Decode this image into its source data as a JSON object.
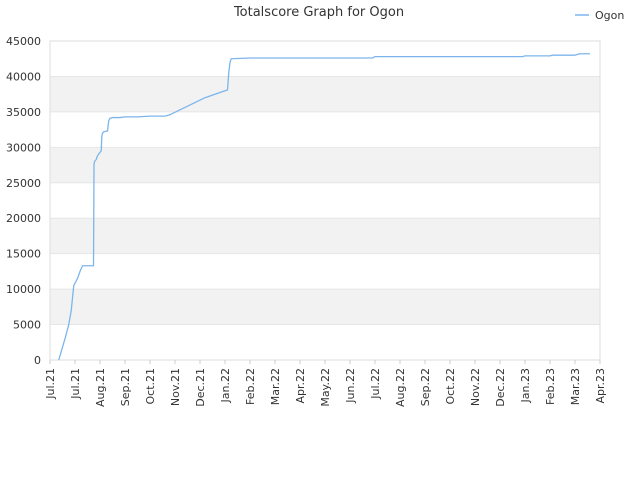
{
  "chart_data": {
    "type": "line",
    "title": "Totalscore Graph for Ogon",
    "xlabel": "",
    "ylabel": "",
    "ylim": [
      0,
      45000
    ],
    "yticks": [
      0,
      5000,
      10000,
      15000,
      20000,
      25000,
      30000,
      35000,
      40000,
      45000
    ],
    "xtick_labels": [
      "Jul.21",
      "Jul.21",
      "Aug.21",
      "Sep.21",
      "Oct.21",
      "Nov.21",
      "Dec.21",
      "Jan.22",
      "Feb.22",
      "Mar.22",
      "Apr.22",
      "May.22",
      "Jun.22",
      "Jul.22",
      "Aug.22",
      "Sep.22",
      "Oct.22",
      "Nov.22",
      "Dec.22",
      "Jan.23",
      "Feb.23",
      "Mar.23",
      "Apr.23"
    ],
    "grid": true,
    "legend_position": "top-right",
    "series": [
      {
        "name": "Ogon",
        "color": "#7cb5ec",
        "points": [
          [
            0.35,
            0
          ],
          [
            0.6,
            3000
          ],
          [
            0.75,
            5000
          ],
          [
            0.85,
            7000
          ],
          [
            0.95,
            10500
          ],
          [
            1.1,
            11500
          ],
          [
            1.2,
            12500
          ],
          [
            1.3,
            13300
          ],
          [
            1.5,
            13300
          ],
          [
            1.7,
            13300
          ],
          [
            1.74,
            13300
          ],
          [
            1.75,
            20000
          ],
          [
            1.76,
            27500
          ],
          [
            1.78,
            28000
          ],
          [
            1.85,
            28300
          ],
          [
            1.9,
            28800
          ],
          [
            2.0,
            29300
          ],
          [
            2.05,
            29500
          ],
          [
            2.07,
            31500
          ],
          [
            2.1,
            32000
          ],
          [
            2.15,
            32200
          ],
          [
            2.3,
            32300
          ],
          [
            2.35,
            33800
          ],
          [
            2.4,
            34100
          ],
          [
            2.5,
            34200
          ],
          [
            2.8,
            34200
          ],
          [
            3.0,
            34300
          ],
          [
            3.5,
            34300
          ],
          [
            4.0,
            34400
          ],
          [
            4.6,
            34400
          ],
          [
            4.8,
            34600
          ],
          [
            5.5,
            35800
          ],
          [
            6.2,
            37000
          ],
          [
            7.1,
            38100
          ],
          [
            7.15,
            40500
          ],
          [
            7.2,
            42000
          ],
          [
            7.25,
            42500
          ],
          [
            8.0,
            42600
          ],
          [
            10.0,
            42600
          ],
          [
            12.0,
            42600
          ],
          [
            12.9,
            42600
          ],
          [
            13.0,
            42800
          ],
          [
            14.5,
            42800
          ],
          [
            16.0,
            42800
          ],
          [
            17.5,
            42800
          ],
          [
            18.9,
            42800
          ],
          [
            19.0,
            42900
          ],
          [
            20.0,
            42900
          ],
          [
            20.1,
            43000
          ],
          [
            21.0,
            43000
          ],
          [
            21.2,
            43200
          ],
          [
            21.6,
            43200
          ]
        ]
      }
    ]
  }
}
